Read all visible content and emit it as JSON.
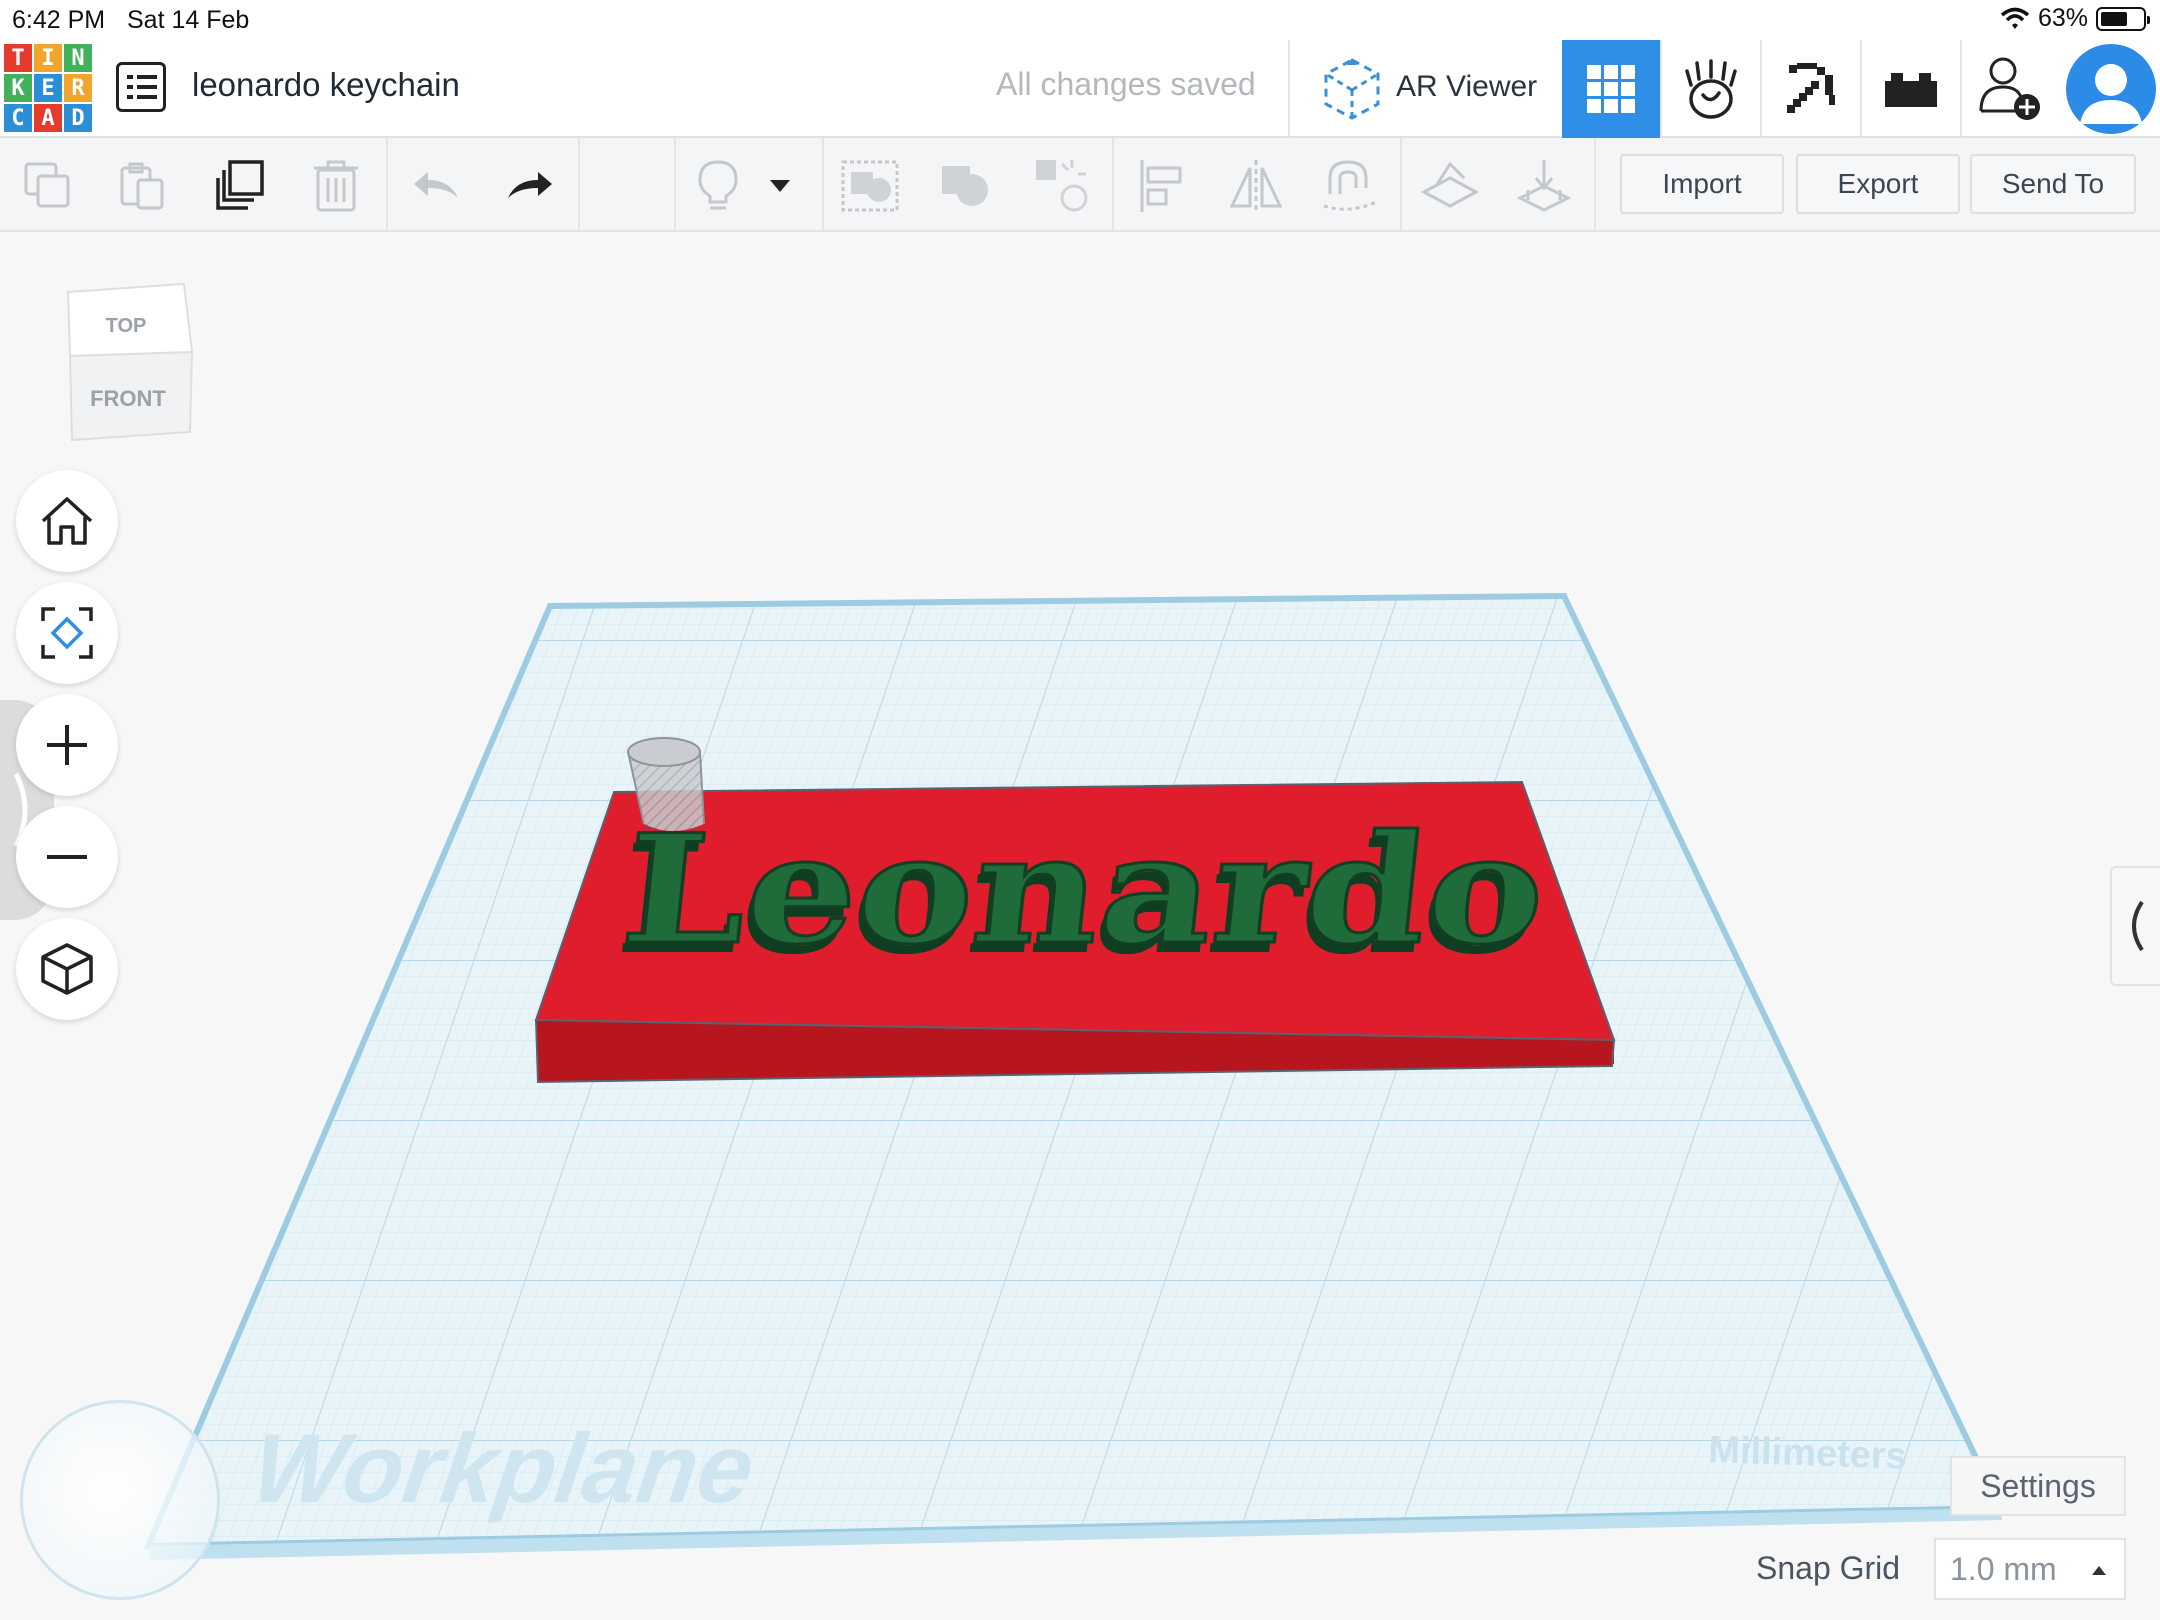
{
  "status_bar": {
    "time": "6:42 PM",
    "date": "Sat 14 Feb",
    "battery": "63%"
  },
  "header": {
    "logo": [
      "T",
      "I",
      "N",
      "K",
      "E",
      "R",
      "C",
      "A",
      "D"
    ],
    "design_title": "leonardo keychain",
    "save_status": "All changes saved",
    "ar_viewer_label": "AR Viewer"
  },
  "toolbar": {
    "import_label": "Import",
    "export_label": "Export",
    "send_to_label": "Send To"
  },
  "view_cube": {
    "top_label": "TOP",
    "front_label": "FRONT"
  },
  "workplane": {
    "label": "Workplane",
    "units_label": "Millimeters",
    "text_object": "Leonardo"
  },
  "bottom": {
    "settings_label": "Settings",
    "snap_grid_label": "Snap Grid",
    "snap_grid_value": "1.0 mm"
  },
  "colors": {
    "accent": "#2f8ee6",
    "base_plate": "#dc1e2d",
    "text_3d": "#1f6b3a",
    "workplane_grid": "#a9d2e6"
  },
  "icons": [
    "wifi-icon",
    "battery-icon",
    "design-list-icon",
    "ar-cube-icon",
    "grid-view-icon",
    "hand-view-icon",
    "pickaxe-icon",
    "brick-icon",
    "add-user-icon",
    "avatar-icon",
    "copy-icon",
    "paste-icon",
    "duplicate-icon",
    "trash-icon",
    "undo-icon",
    "redo-icon",
    "lightbulb-icon",
    "dropdown-arrow-icon",
    "group-icon",
    "ungroup-icon",
    "align-icon",
    "flip-icon",
    "magnet-icon",
    "workplane-tool-icon",
    "ruler-icon",
    "home-icon",
    "fit-view-icon",
    "zoom-in-icon",
    "zoom-out-icon",
    "perspective-icon"
  ]
}
